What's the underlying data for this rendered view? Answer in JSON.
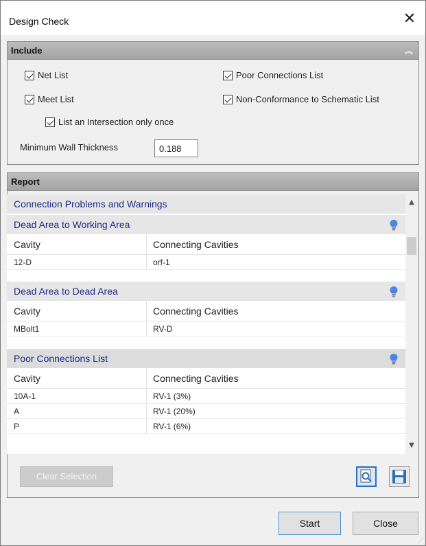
{
  "window": {
    "title": "Design Check"
  },
  "include": {
    "header": "Include",
    "options": {
      "net_list": "Net List",
      "meet_list": "Meet List",
      "intersection_once": "List an Intersection only once",
      "poor_connections": "Poor Connections List",
      "non_conformance": "Non-Conformance to Schematic List"
    },
    "wall_label": "Minimum Wall Thickness",
    "wall_value": "0.188"
  },
  "report": {
    "header": "Report",
    "groups": [
      {
        "title": "Connection Problems and Warnings"
      },
      {
        "title": "Dead Area to Working Area",
        "col1": "Cavity",
        "col2": "Connecting Cavities",
        "rows": [
          {
            "cavity": "12-D",
            "connecting": "orf-1"
          }
        ]
      },
      {
        "title": "Dead Area to Dead Area",
        "col1": "Cavity",
        "col2": "Connecting Cavities",
        "rows": [
          {
            "cavity": "MBolt1",
            "connecting": "RV-D"
          }
        ]
      },
      {
        "title": "Poor Connections List",
        "col1": "Cavity",
        "col2": "Connecting Cavities",
        "rows": [
          {
            "cavity": "10A-1",
            "connecting": "RV-1 (3%)"
          },
          {
            "cavity": "A",
            "connecting": "RV-1 (20%)"
          },
          {
            "cavity": "P",
            "connecting": "RV-1 (6%)"
          }
        ]
      }
    ]
  },
  "buttons": {
    "clear_selection": "Clear Selection",
    "start": "Start",
    "close": "Close"
  },
  "colors": {
    "group_text": "#1f2a8a",
    "accent": "#2b6fc0"
  }
}
